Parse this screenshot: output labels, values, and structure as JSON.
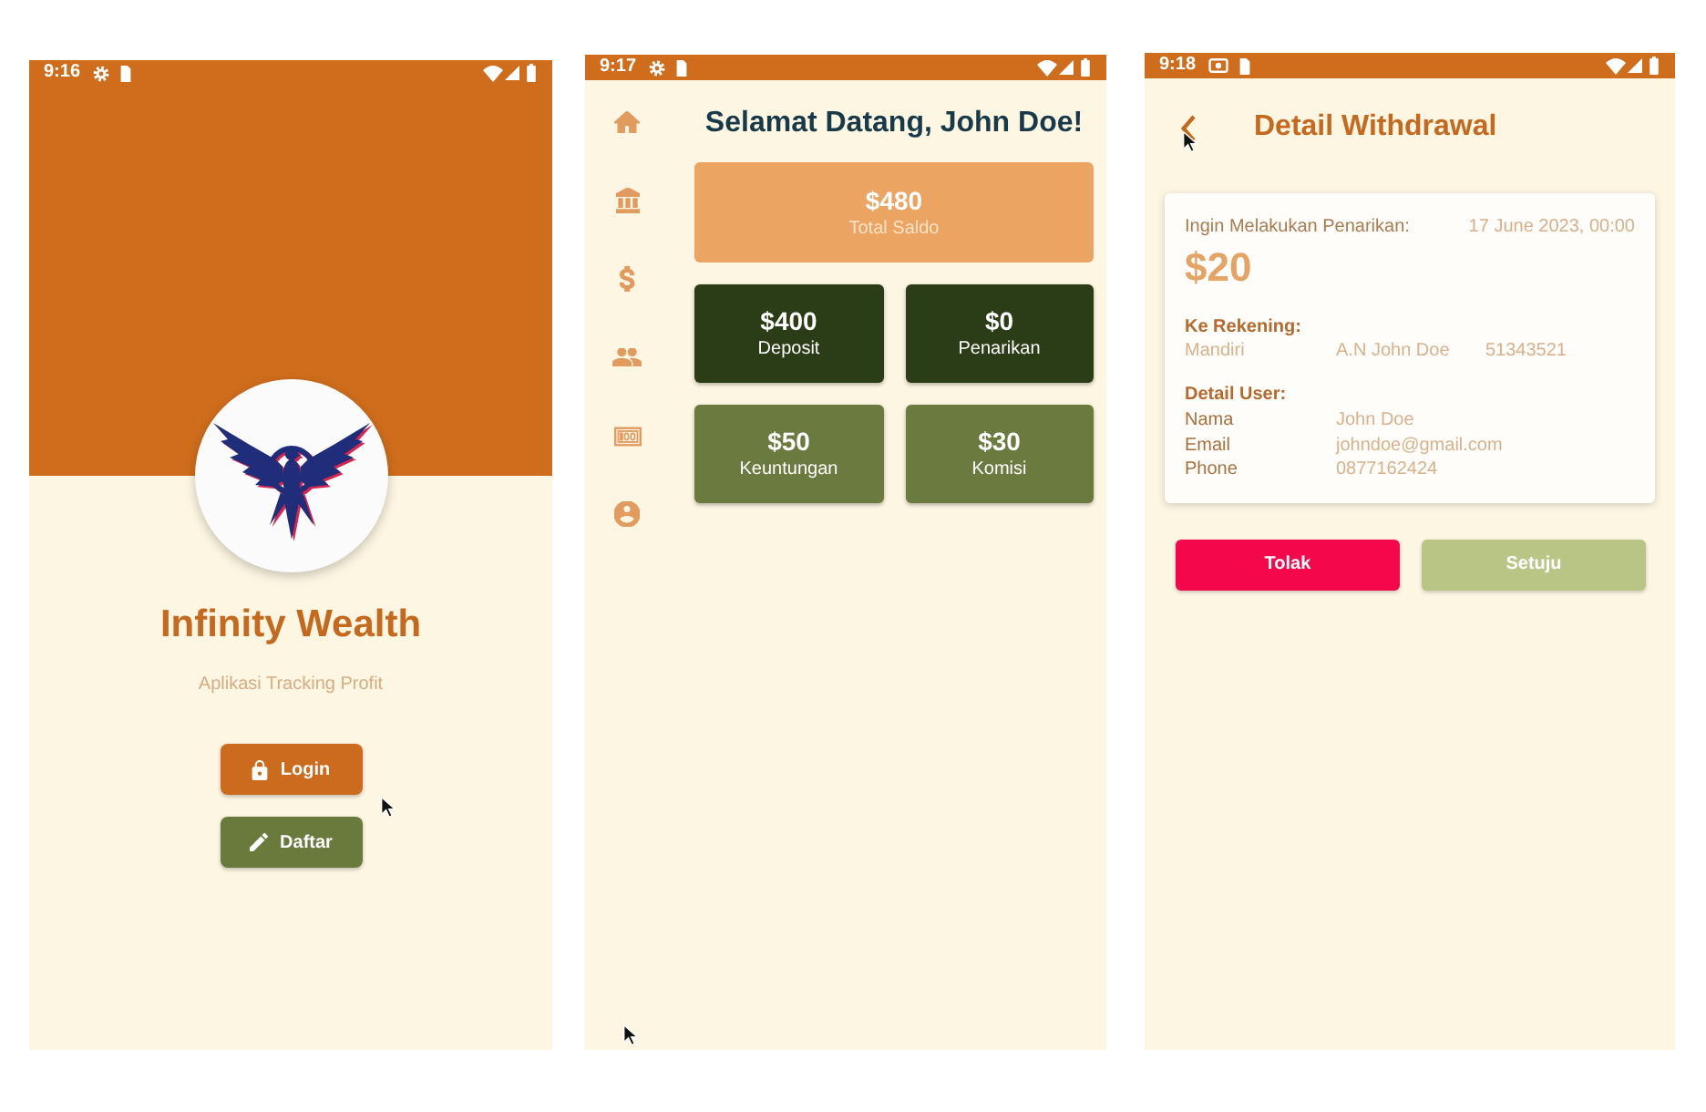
{
  "screens": [
    {
      "kind": "login",
      "status_bar": {
        "time": "9:16"
      },
      "app_name": "Infinity Wealth",
      "tagline": "Aplikasi Tracking Profit",
      "buttons": [
        {
          "label": "Login",
          "kind": "primary"
        },
        {
          "label": "Daftar",
          "kind": "secondary"
        }
      ]
    },
    {
      "kind": "dashboard",
      "status_bar": {
        "time": "9:17"
      },
      "greeting": "Selamat Datang, John Doe!",
      "balance": {
        "amount": "$480",
        "label": "Total Saldo"
      },
      "stats": [
        {
          "value": "$400",
          "label": "Deposit",
          "color": "#2b3d17"
        },
        {
          "value": "$0",
          "label": "Penarikan",
          "color": "#2b3d17"
        },
        {
          "value": "$50",
          "label": "Keuntungan",
          "color": "#6b7a3f"
        },
        {
          "value": "$30",
          "label": "Komisi",
          "color": "#6b7a3f"
        }
      ]
    },
    {
      "kind": "withdrawal_detail",
      "status_bar": {
        "time": "9:18"
      },
      "title": "Detail Withdrawal",
      "request": {
        "label": "Ingin Melakukan Penarikan:",
        "date": "17 June 2023, 00:00",
        "amount": "$20"
      },
      "account": {
        "heading": "Ke Rekening:",
        "bank": "Mandiri",
        "holder": "A.N John Doe",
        "number": "51343521"
      },
      "user": {
        "heading": "Detail User:",
        "fields": [
          {
            "label": "Nama",
            "value": "John Doe"
          },
          {
            "label": "Email",
            "value": "johndoe@gmail.com"
          },
          {
            "label": "Phone",
            "value": "0877162424"
          }
        ]
      },
      "actions": [
        {
          "label": "Tolak",
          "kind": "reject"
        },
        {
          "label": "Setuju",
          "kind": "approve"
        }
      ]
    }
  ]
}
